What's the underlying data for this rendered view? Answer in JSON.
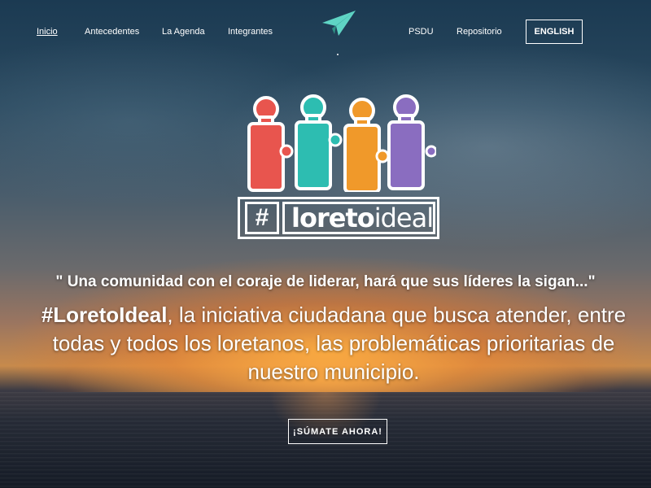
{
  "nav": {
    "left_links": [
      {
        "label": "Inicio",
        "active": true
      },
      {
        "label": "Antecedentes",
        "active": false
      },
      {
        "label": "La Agenda",
        "active": false
      },
      {
        "label": "Integrantes",
        "active": false
      }
    ],
    "right_links": [
      {
        "label": "PSDU"
      },
      {
        "label": "Repositorio"
      }
    ],
    "language_button": "ENGLISH",
    "logo_icon": "paper-plane-icon"
  },
  "brand": {
    "hash": "#",
    "word_bold": "loreto",
    "word_light": "ideal",
    "puzzle_colors": [
      "#e8554e",
      "#2dbdb1",
      "#f0992a",
      "#8a6dc0"
    ]
  },
  "hero": {
    "quote": "\" Una comunidad con el coraje de liderar, hará que sus líderes la sigan...\"",
    "hashtag": "#LoretoIdeal",
    "description_line1": ", la iniciativa ciudadana que busca atender, entre",
    "description_line2": "todas y todos los loretanos, las problemáticas prioritarias de",
    "description_line3": "nuestro municipio.",
    "cta_label": "¡SÚMATE AHORA!"
  },
  "colors": {
    "accent": "#5fd4c4",
    "text": "#ffffff"
  }
}
